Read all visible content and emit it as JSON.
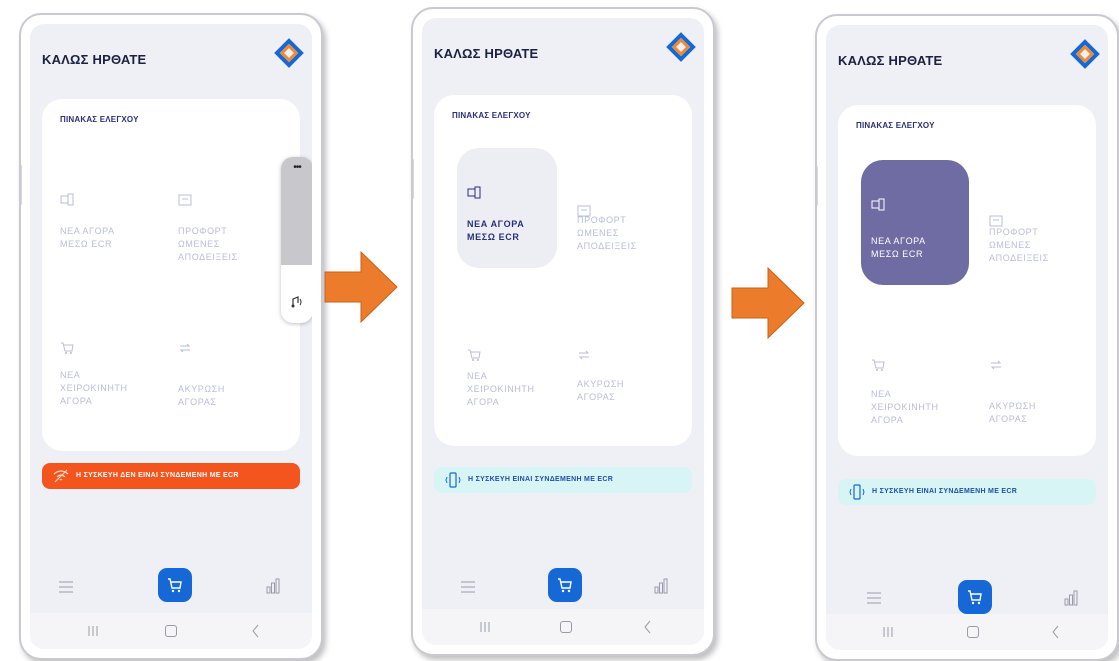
{
  "screens": [
    {
      "header": {
        "title": "ΚΑΛΩΣ ΗΡΘΑΤΕ"
      },
      "panel": {
        "title": "ΠΙΝΑΚΑΣ ΕΛΕΓΧΟΥ"
      },
      "tiles": [
        {
          "label": "ΝΕΑ ΑΓΟΡΑ\nΜΕΣΩ ECR",
          "state": "normal"
        },
        {
          "label": "ΠΡΟΦΟΡΤ\nΩΜΕΝΕΣ\nΑΠΟΔΕΙΞΕΙΣ",
          "state": "normal"
        },
        {
          "label": "ΝΕΑ\nΧΕΙΡΟΚΙΝΗΤΗ\nΑΓΟΡΑ",
          "state": "normal"
        },
        {
          "label": "ΑΚΥΡΩΣΗ\nΑΓΟΡΑΣ",
          "state": "normal"
        }
      ],
      "status": {
        "text": "Η ΣΥΣΚΕΥΗ ΔΕΝ ΕΙΝΑΙ ΣΥΝΔΕΜΕΝΗ ΜΕ ECR",
        "type": "disconnected"
      },
      "floating_toolbar": {
        "more": "•••"
      }
    },
    {
      "header": {
        "title": "ΚΑΛΩΣ ΗΡΘΑΤΕ"
      },
      "panel": {
        "title": "ΠΙΝΑΚΑΣ ΕΛΕΓΧΟΥ"
      },
      "tiles": [
        {
          "label": "ΝΕΑ ΑΓΟΡΑ\nΜΕΣΩ ECR",
          "state": "hover"
        },
        {
          "label": "ΠΡΟΦΟΡΤ\nΩΜΕΝΕΣ\nΑΠΟΔΕΙΞΕΙΣ",
          "state": "normal"
        },
        {
          "label": "ΝΕΑ\nΧΕΙΡΟΚΙΝΗΤΗ\nΑΓΟΡΑ",
          "state": "normal"
        },
        {
          "label": "ΑΚΥΡΩΣΗ\nΑΓΟΡΑΣ",
          "state": "normal"
        }
      ],
      "status": {
        "text": "Η ΣΥΣΚΕΥΗ ΕΙΝΑΙ ΣΥΝΔΕΜΕΝΗ ΜΕ ECR",
        "type": "connected"
      }
    },
    {
      "header": {
        "title": "ΚΑΛΩΣ ΗΡΘΑΤΕ"
      },
      "panel": {
        "title": "ΠΙΝΑΚΑΣ ΕΛΕΓΧΟΥ"
      },
      "tiles": [
        {
          "label": "ΝΕΑ ΑΓΟΡΑ\nΜΕΣΩ ECR",
          "state": "selected"
        },
        {
          "label": "ΠΡΟΦΟΡΤ\nΩΜΕΝΕΣ\nΑΠΟΔΕΙΞΕΙΣ",
          "state": "normal"
        },
        {
          "label": "ΝΕΑ\nΧΕΙΡΟΚΙΝΗΤΗ\nΑΓΟΡΑ",
          "state": "normal"
        },
        {
          "label": "ΑΚΥΡΩΣΗ\nΑΓΟΡΑΣ",
          "state": "normal"
        }
      ],
      "status": {
        "text": "Η ΣΥΣΚΕΥΗ ΕΙΝΑΙ ΣΥΝΔΕΜΕΝΗ ΜΕ ECR",
        "type": "connected"
      }
    }
  ],
  "icons": {
    "logo": "brand-logo",
    "tiles": [
      "ecr-device-icon",
      "receipt-icon",
      "cart-icon",
      "cancel-exchange-icon"
    ],
    "nav": [
      "list-icon",
      "cart-icon",
      "chart-icon"
    ],
    "system": [
      "recents-icon",
      "home-icon",
      "back-icon"
    ]
  },
  "colors": {
    "brand_blue": "#1568d6",
    "logo_orange": "#f08a2c",
    "disconnected_banner": "#f4551f",
    "connected_banner": "#d8f5f5",
    "selected_tile": "#6f6ca3",
    "hover_tile": "#eceef4",
    "arrow": "#ec7b2c"
  }
}
